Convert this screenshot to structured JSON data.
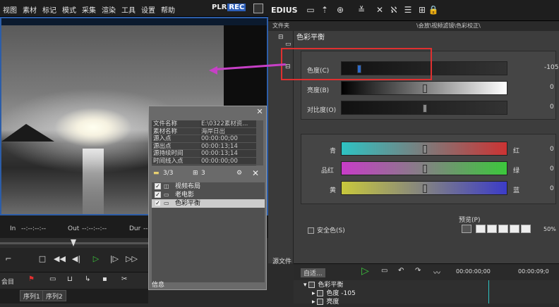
{
  "left_menu": [
    "视图",
    "素材",
    "标记",
    "模式",
    "采集",
    "渲染",
    "工具",
    "设置",
    "帮助"
  ],
  "plr": {
    "plr": "PLR",
    "rec": "REC"
  },
  "inout": {
    "in_label": "In",
    "in_value": "--:--:--:--",
    "out_label": "Out",
    "out_value": "--:--:--:--",
    "dur_label": "Dur",
    "dur_value": "--:--:--:--"
  },
  "seq_tabs": [
    "序列1",
    "序列2"
  ],
  "seq_toolbar_label": "会目",
  "info": {
    "rows": [
      {
        "k": "文件名称",
        "v": "E:\\0322素材资..."
      },
      {
        "k": "素材名称",
        "v": "海岸日出"
      },
      {
        "k": "源入点",
        "v": "00:00:00;00"
      },
      {
        "k": "源出点",
        "v": "00:00:13;14"
      },
      {
        "k": "源持续时间",
        "v": "00:00:13;14"
      },
      {
        "k": "时间线入点",
        "v": "00:00:00;00"
      }
    ],
    "count": "3/3",
    "count2": "3",
    "items": [
      {
        "label": "视频布局",
        "checked": "✓"
      },
      {
        "label": "老电影",
        "checked": "✓"
      },
      {
        "label": "色彩平衡",
        "checked": "✓"
      }
    ],
    "footer": "信息"
  },
  "edius": {
    "title": "EDIUS"
  },
  "bin": {
    "left": "文件夹",
    "path": "\\会放\\视频滤镜\\色彩校正\\"
  },
  "effect": {
    "title": "色彩平衡",
    "hue_label": "色度(C)",
    "hue_value": "-105",
    "bright_label": "亮度(B)",
    "bright_value": "0",
    "contrast_label": "对比度(O)",
    "contrast_value": "0",
    "cyan": "青",
    "red": "红",
    "magenta": "品红",
    "green": "绿",
    "yellow": "黄",
    "blue": "蓝",
    "cr_value": "0",
    "mg_value": "0",
    "yb_value": "0",
    "safe_color": "安全色(S)",
    "preview": "预览(P)",
    "preview_pct": "50%"
  },
  "src_label": "源文件",
  "timeline": {
    "mode": "自适...",
    "row1": "色彩平衡",
    "row2_label": "色度",
    "row2_value": "-105",
    "row3": "亮度",
    "tc1": "00:00:00;00",
    "tc2": "00:00:09;0"
  }
}
